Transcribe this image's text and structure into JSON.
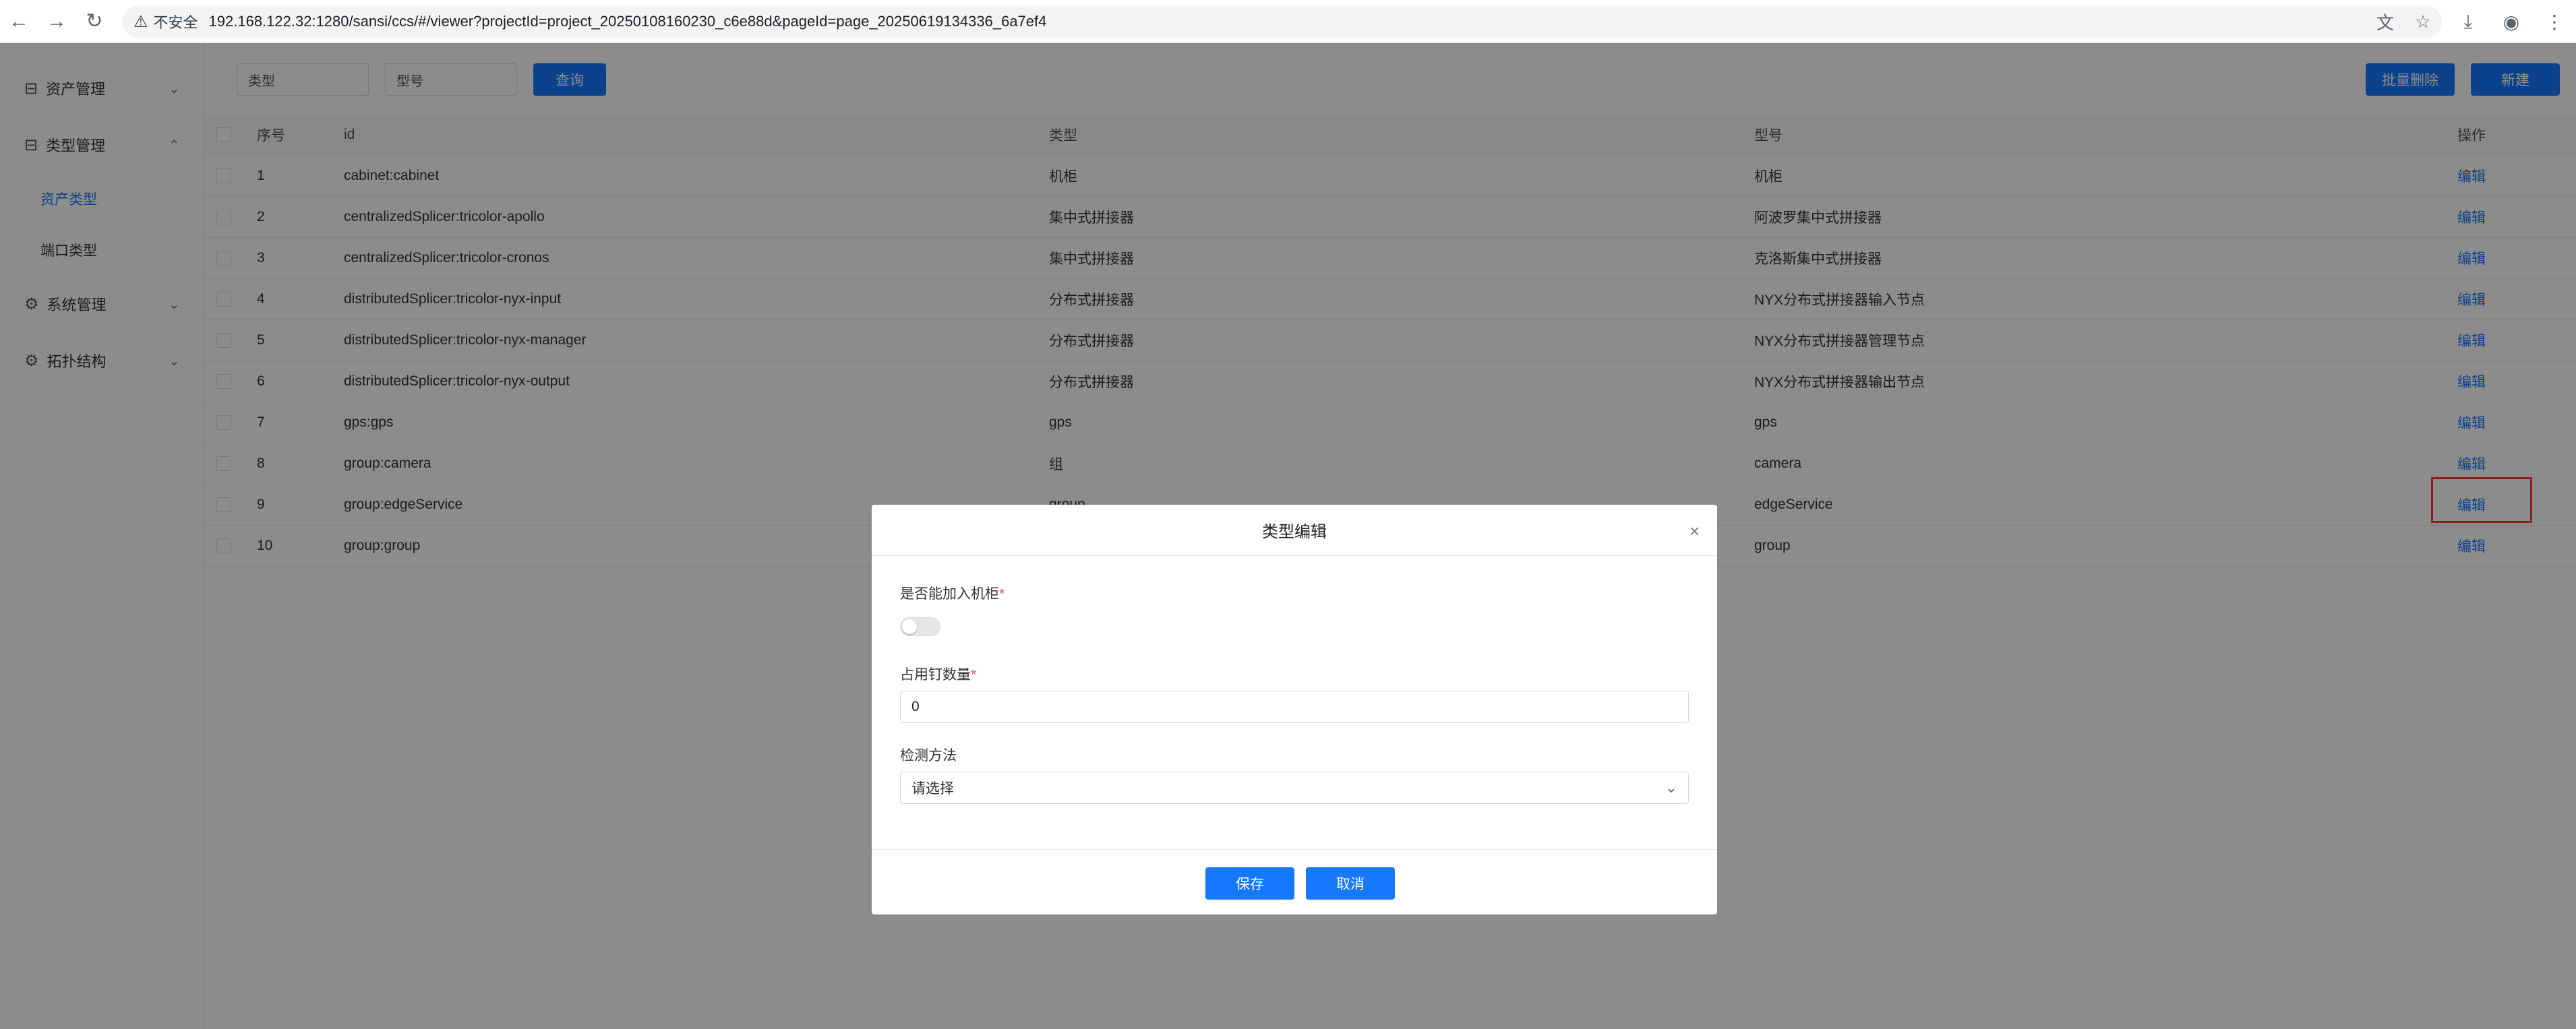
{
  "browser": {
    "security_text": "不安全",
    "url": "192.168.122.32:1280/sansi/ccs/#/viewer?projectId=project_20250108160230_c6e88d&pageId=page_20250619134336_6a7ef4"
  },
  "sidebar": {
    "items": [
      {
        "label": "资产管理"
      },
      {
        "label": "类型管理"
      },
      {
        "label": "系统管理"
      },
      {
        "label": "拓扑结构"
      }
    ],
    "sub_items": [
      {
        "label": "资产类型"
      },
      {
        "label": "端口类型"
      }
    ]
  },
  "toolbar": {
    "type_placeholder": "类型",
    "model_placeholder": "型号",
    "query_label": "查询",
    "batch_delete_label": "批量删除",
    "new_label": "新建"
  },
  "table": {
    "headers": {
      "index": "序号",
      "id": "id",
      "type": "类型",
      "model": "型号",
      "op": "操作"
    },
    "rows": [
      {
        "index": "1",
        "id": "cabinet:cabinet",
        "type": "机柜",
        "model": "机柜",
        "op": "编辑"
      },
      {
        "index": "2",
        "id": "centralizedSplicer:tricolor-apollo",
        "type": "集中式拼接器",
        "model": "阿波罗集中式拼接器",
        "op": "编辑"
      },
      {
        "index": "3",
        "id": "centralizedSplicer:tricolor-cronos",
        "type": "集中式拼接器",
        "model": "克洛斯集中式拼接器",
        "op": "编辑"
      },
      {
        "index": "4",
        "id": "distributedSplicer:tricolor-nyx-input",
        "type": "分布式拼接器",
        "model": "NYX分布式拼接器输入节点",
        "op": "编辑"
      },
      {
        "index": "5",
        "id": "distributedSplicer:tricolor-nyx-manager",
        "type": "分布式拼接器",
        "model": "NYX分布式拼接器管理节点",
        "op": "编辑"
      },
      {
        "index": "6",
        "id": "distributedSplicer:tricolor-nyx-output",
        "type": "分布式拼接器",
        "model": "NYX分布式拼接器输出节点",
        "op": "编辑"
      },
      {
        "index": "7",
        "id": "gps:gps",
        "type": "gps",
        "model": "gps",
        "op": "编辑"
      },
      {
        "index": "8",
        "id": "group:camera",
        "type": "组",
        "model": "camera",
        "op": "编辑"
      },
      {
        "index": "9",
        "id": "group:edgeService",
        "type": "group",
        "model": "edgeService",
        "op": "编辑"
      },
      {
        "index": "10",
        "id": "group:group",
        "type": "",
        "model": "group",
        "op": "编辑"
      }
    ]
  },
  "modal": {
    "title": "类型编辑",
    "field1_label": "是否能加入机柜",
    "field1_enabled": false,
    "field2_label": "占用钉数量",
    "field2_value": "0",
    "field3_label": "检测方法",
    "field3_placeholder": "请选择",
    "required_mark": "*",
    "save_label": "保存",
    "cancel_label": "取消"
  },
  "colors": {
    "primary": "#1677ff",
    "required": "#ff4d4f",
    "highlight": "#ff3b30"
  }
}
